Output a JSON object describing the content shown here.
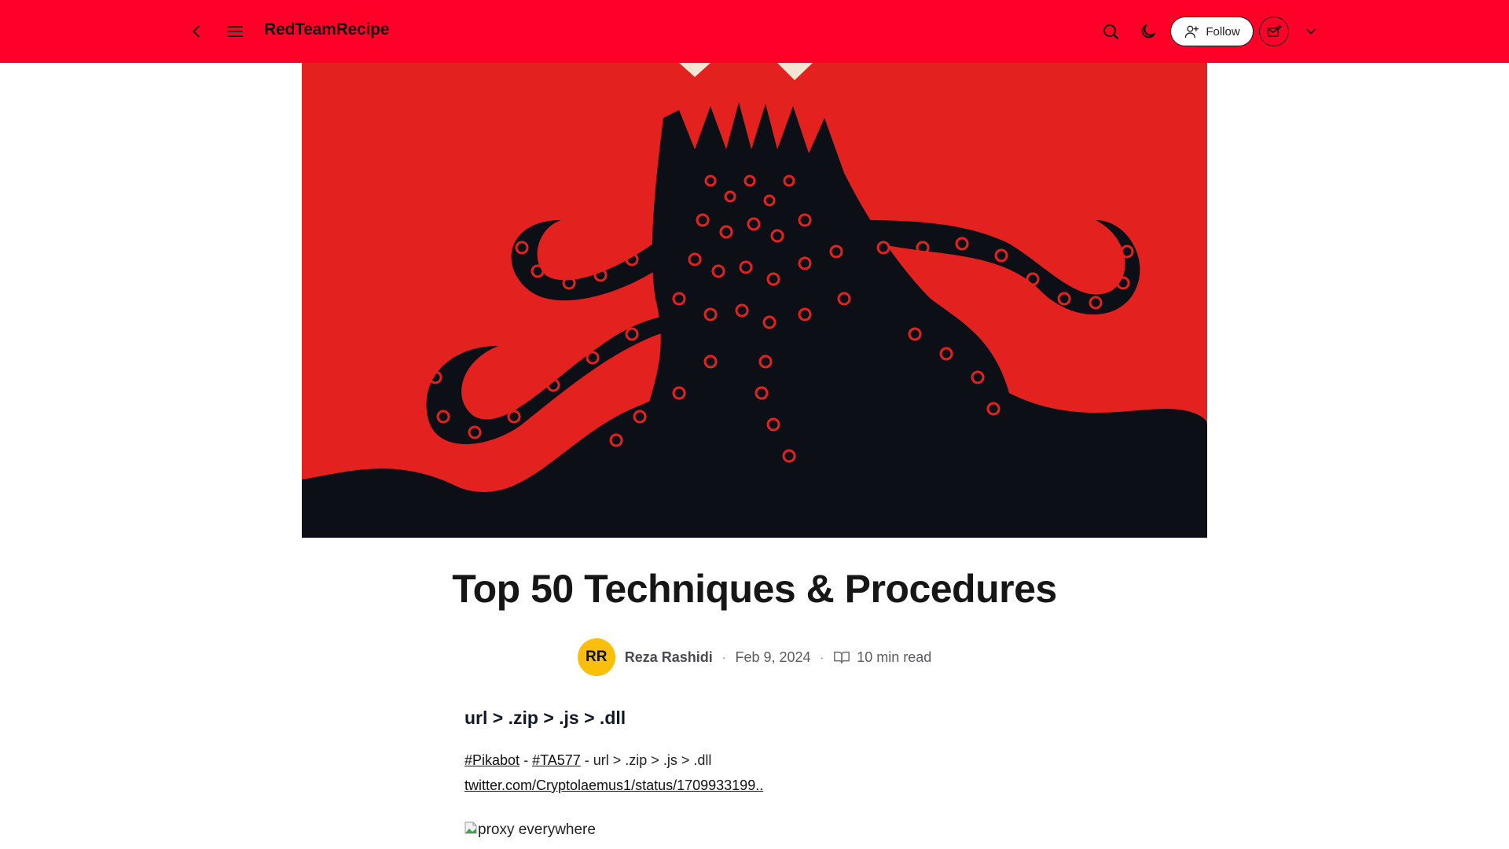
{
  "header": {
    "brand": "RedTeamRecipe",
    "back_icon": "chevron-left-icon",
    "menu_icon": "hamburger-menu-icon",
    "search_icon": "search-icon",
    "theme_icon": "moon-icon",
    "follow_label": "Follow",
    "follow_icon": "user-plus-icon",
    "subscribe_icon": "mail-plus-icon",
    "more_icon": "chevron-down-icon",
    "background": "#ff0029"
  },
  "hero": {
    "alt": "Black octopus silhouette on red background",
    "colors": {
      "background": "#e32220",
      "ink": "#0c1016",
      "accent": "#f3e6d3"
    }
  },
  "article": {
    "title": "Top 50 Techniques & Procedures",
    "author_initials": "RR",
    "author": "Reza Rashidi",
    "date": "Feb 9, 2024",
    "read_time": "10 min read",
    "separator": "·",
    "section_heading": "url > .zip > .js > .dll",
    "tag1": "#Pikabot",
    "dash": " - ",
    "tag2": "#TA577",
    "tail": " - url > .zip > .js > .dll",
    "link": "twitter.com/Cryptolaemus1/status/1709933199..",
    "image_alt": "proxy everywhere"
  }
}
